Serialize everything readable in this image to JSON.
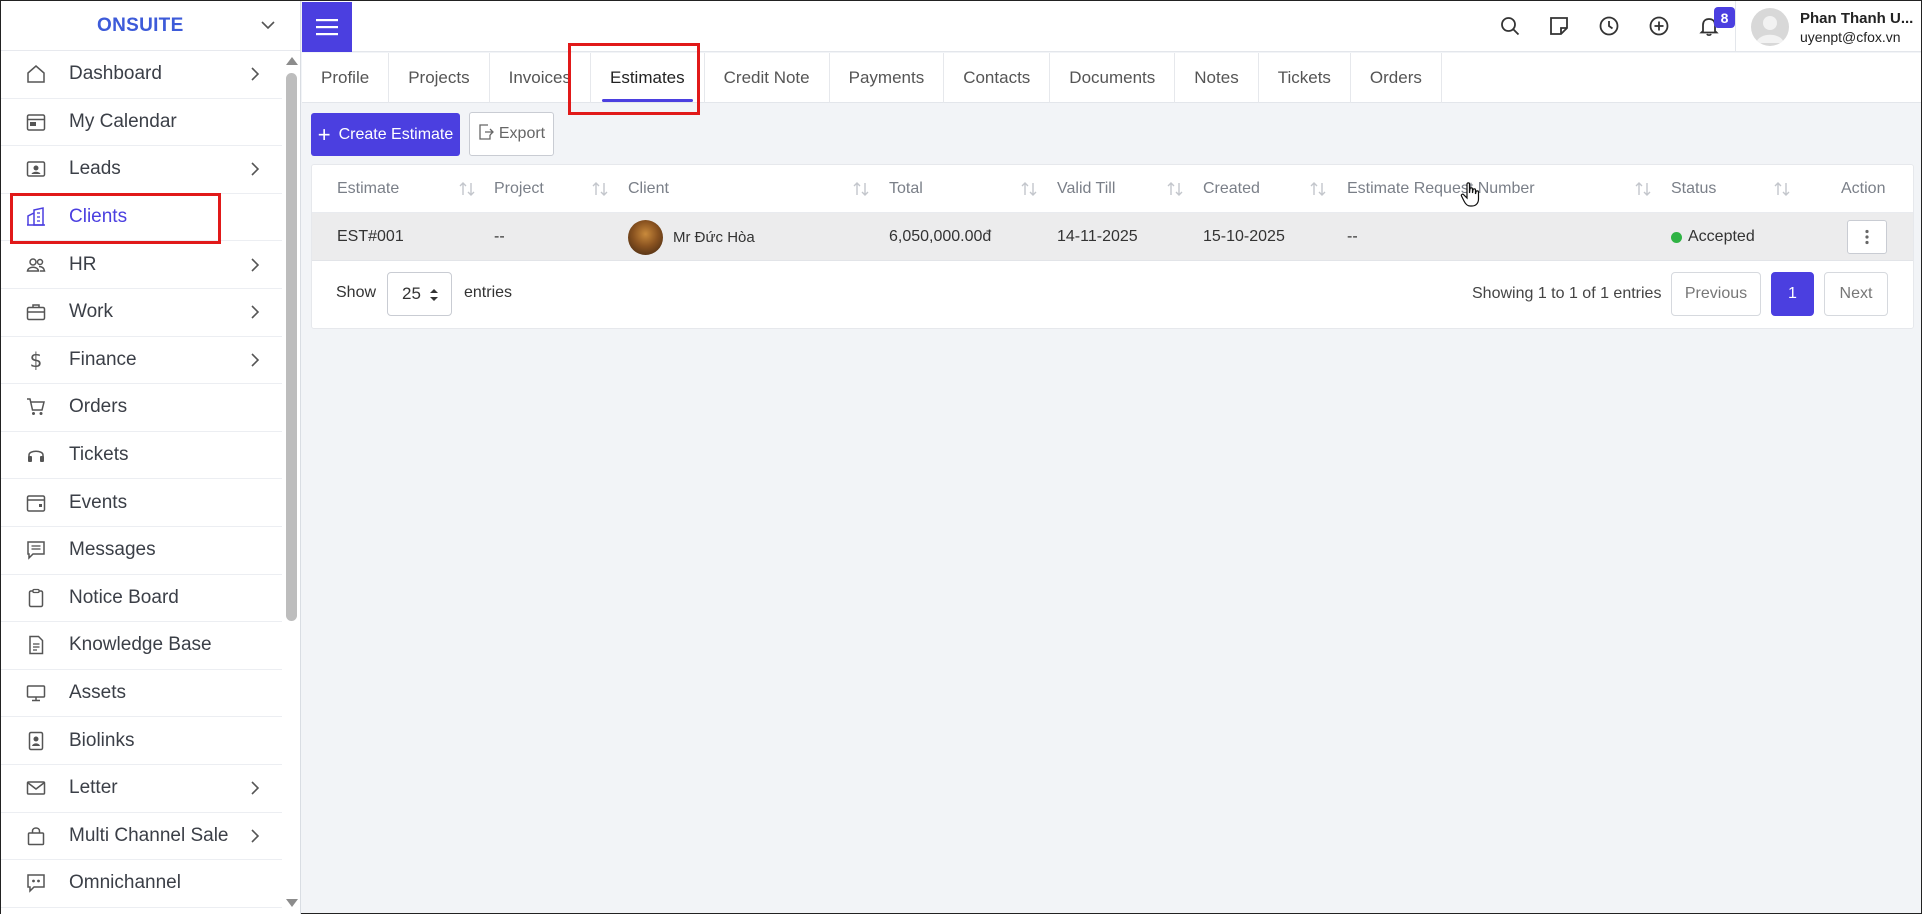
{
  "brand": {
    "name": "ONSUITE"
  },
  "sidebar": {
    "items": [
      {
        "label": "Dashboard",
        "icon": "home-icon",
        "has_children": true
      },
      {
        "label": "My Calendar",
        "icon": "calendar-icon",
        "has_children": false
      },
      {
        "label": "Leads",
        "icon": "id-card-icon",
        "has_children": true
      },
      {
        "label": "Clients",
        "icon": "buildings-icon",
        "has_children": false,
        "active": true
      },
      {
        "label": "HR",
        "icon": "people-icon",
        "has_children": true
      },
      {
        "label": "Work",
        "icon": "briefcase-icon",
        "has_children": true
      },
      {
        "label": "Finance",
        "icon": "dollar-icon",
        "has_children": true
      },
      {
        "label": "Orders",
        "icon": "cart-icon",
        "has_children": false
      },
      {
        "label": "Tickets",
        "icon": "headset-icon",
        "has_children": false
      },
      {
        "label": "Events",
        "icon": "calendar-event-icon",
        "has_children": false
      },
      {
        "label": "Messages",
        "icon": "message-icon",
        "has_children": false
      },
      {
        "label": "Notice Board",
        "icon": "clipboard-icon",
        "has_children": false
      },
      {
        "label": "Knowledge Base",
        "icon": "document-icon",
        "has_children": false
      },
      {
        "label": "Assets",
        "icon": "monitor-icon",
        "has_children": false
      },
      {
        "label": "Biolinks",
        "icon": "person-badge-icon",
        "has_children": false
      },
      {
        "label": "Letter",
        "icon": "envelope-icon",
        "has_children": true
      },
      {
        "label": "Multi Channel Sale",
        "icon": "bag-icon",
        "has_children": true
      },
      {
        "label": "Omnichannel",
        "icon": "chat-quote-icon",
        "has_children": false
      }
    ]
  },
  "topbar": {
    "notification_count": "8",
    "user_name": "Phan Thanh U...",
    "user_email": "uyenpt@cfox.vn"
  },
  "tabs": [
    {
      "label": "Profile"
    },
    {
      "label": "Projects"
    },
    {
      "label": "Invoices"
    },
    {
      "label": "Estimates",
      "active": true
    },
    {
      "label": "Credit Note"
    },
    {
      "label": "Payments"
    },
    {
      "label": "Contacts"
    },
    {
      "label": "Documents"
    },
    {
      "label": "Notes"
    },
    {
      "label": "Tickets"
    },
    {
      "label": "Orders"
    }
  ],
  "actions": {
    "create_label": "Create Estimate",
    "export_label": "Export"
  },
  "table": {
    "columns": [
      "Estimate",
      "Project",
      "Client",
      "Total",
      "Valid Till",
      "Created",
      "Estimate Request Number",
      "Status",
      "Action"
    ],
    "rows": [
      {
        "estimate": "EST#001",
        "project": "--",
        "client": "Mr Đức Hòa",
        "total": "6,050,000.00đ",
        "valid_till": "14-11-2025",
        "created": "15-10-2025",
        "request_number": "--",
        "status": "Accepted",
        "status_color": "#2fb344"
      }
    ]
  },
  "pagination": {
    "show_label": "Show",
    "page_size": "25",
    "entries_label": "entries",
    "summary": "Showing 1 to 1 of 1 entries",
    "previous_label": "Previous",
    "current_page": "1",
    "next_label": "Next"
  },
  "colors": {
    "accent": "#4b3fe0",
    "brand": "#3d5bd9",
    "highlight_box": "#e11919"
  }
}
